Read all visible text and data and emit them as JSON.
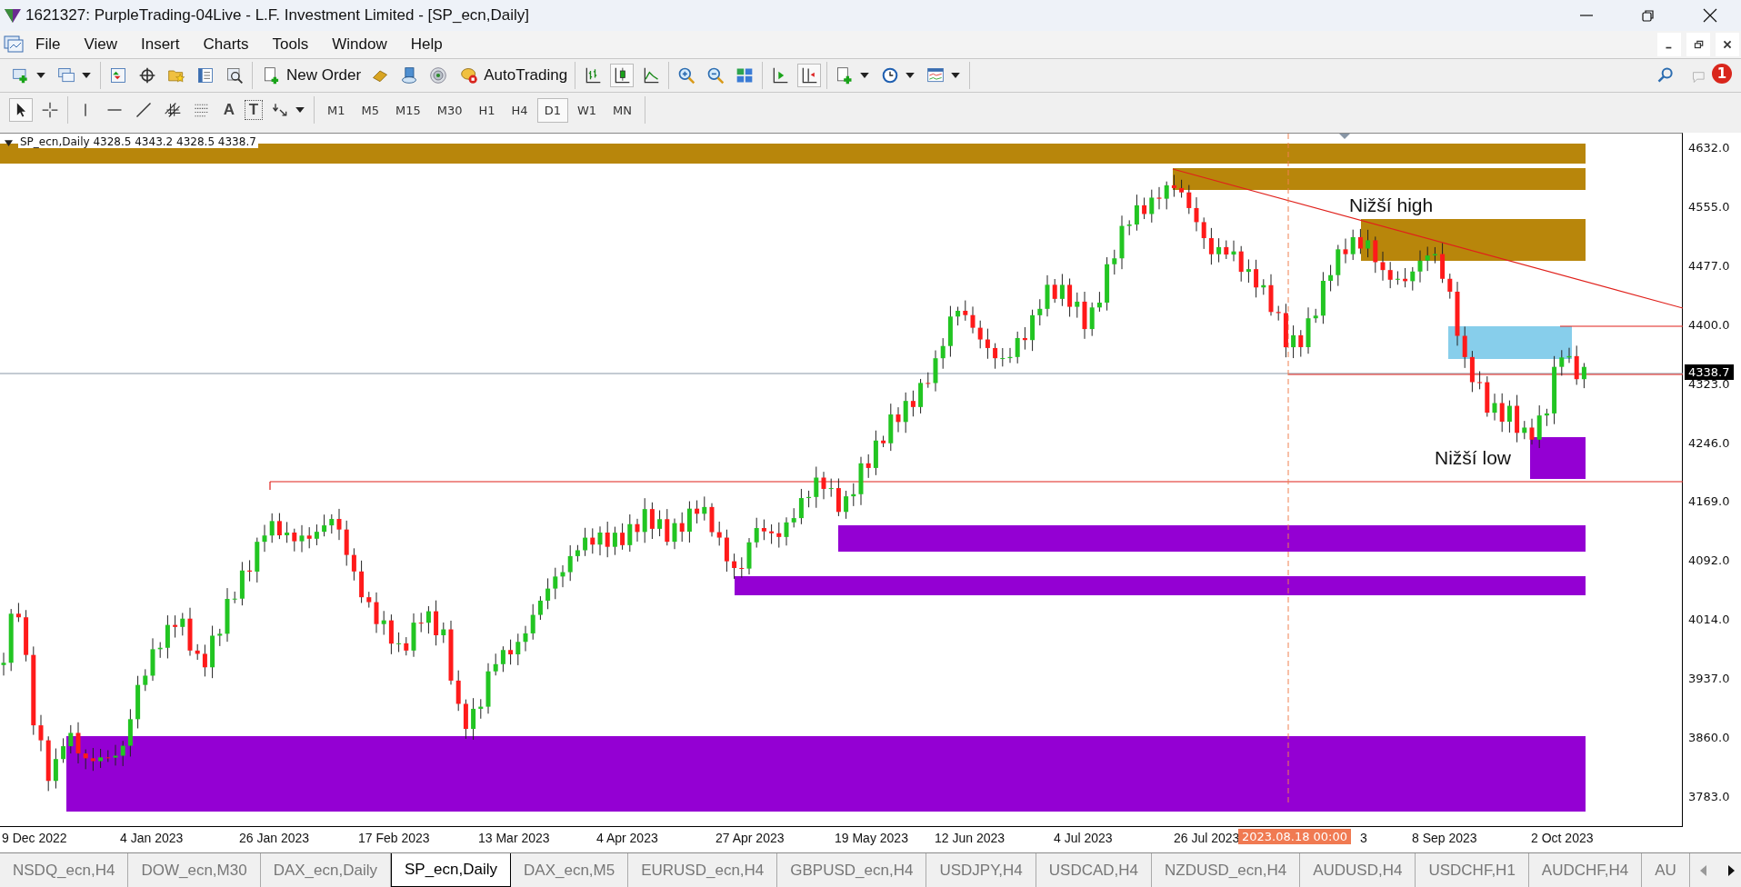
{
  "window": {
    "title": "1621327: PurpleTrading-04Live - L.F. Investment Limited - [SP_ecn,Daily]"
  },
  "menu": [
    "File",
    "View",
    "Insert",
    "Charts",
    "Tools",
    "Window",
    "Help"
  ],
  "toolbar": {
    "new_order": "New Order",
    "autotrading": "AutoTrading",
    "chart_modes": [
      {
        "selected": false
      },
      {
        "selected": true
      },
      {
        "selected": false
      }
    ],
    "autoscroll_on": false,
    "chart_shift_on": true,
    "notifications": "1"
  },
  "drawing_toolbar": {
    "cursor_modes": [
      {
        "selected": true
      },
      {
        "selected": false
      }
    ],
    "text_tools": [
      "A",
      "T"
    ],
    "timeframes": [
      {
        "label": "M1",
        "selected": false
      },
      {
        "label": "M5",
        "selected": false
      },
      {
        "label": "M15",
        "selected": false
      },
      {
        "label": "M30",
        "selected": false
      },
      {
        "label": "H1",
        "selected": false
      },
      {
        "label": "H4",
        "selected": false
      },
      {
        "label": "D1",
        "selected": true
      },
      {
        "label": "W1",
        "selected": false
      },
      {
        "label": "MN",
        "selected": false
      }
    ]
  },
  "chart": {
    "header": "SP_ecn,Daily  4328.5 4343.2 4328.5 4338.7",
    "annotations": [
      "Nižší high",
      "Nižší low"
    ],
    "price_ticks": [
      "4632.0",
      "4555.0",
      "4477.0",
      "4400.0",
      "4323.0",
      "4246.0",
      "4169.0",
      "4092.0",
      "4014.0",
      "3937.0",
      "3860.0",
      "3783.0"
    ],
    "current_price": "4338.7",
    "date_ticks": [
      "9 Dec 2022",
      "4 Jan 2023",
      "26 Jan 2023",
      "17 Feb 2023",
      "13 Mar 2023",
      "4 Apr 2023",
      "27 Apr 2023",
      "19 May 2023",
      "12 Jun 2023",
      "4 Jul 2023",
      "26 Jul 2023",
      "3",
      "8 Sep 2023",
      "2 Oct 2023"
    ],
    "cursor_date": "2023.08.18 00:00"
  },
  "tabs": [
    {
      "label": "NSDQ_ecn,H4",
      "selected": false
    },
    {
      "label": "DOW_ecn,M30",
      "selected": false
    },
    {
      "label": "DAX_ecn,Daily",
      "selected": false
    },
    {
      "label": "SP_ecn,Daily",
      "selected": true
    },
    {
      "label": "DAX_ecn,M5",
      "selected": false
    },
    {
      "label": "EURUSD_ecn,H4",
      "selected": false
    },
    {
      "label": "GBPUSD_ecn,H4",
      "selected": false
    },
    {
      "label": "USDJPY,H4",
      "selected": false
    },
    {
      "label": "USDCAD,H4",
      "selected": false
    },
    {
      "label": "NZDUSD_ecn,H4",
      "selected": false
    },
    {
      "label": "AUDUSD,H4",
      "selected": false
    },
    {
      "label": "USDCHF,H1",
      "selected": false
    },
    {
      "label": "AUDCHF,H4",
      "selected": false
    },
    {
      "label": "AU",
      "selected": false
    }
  ]
}
